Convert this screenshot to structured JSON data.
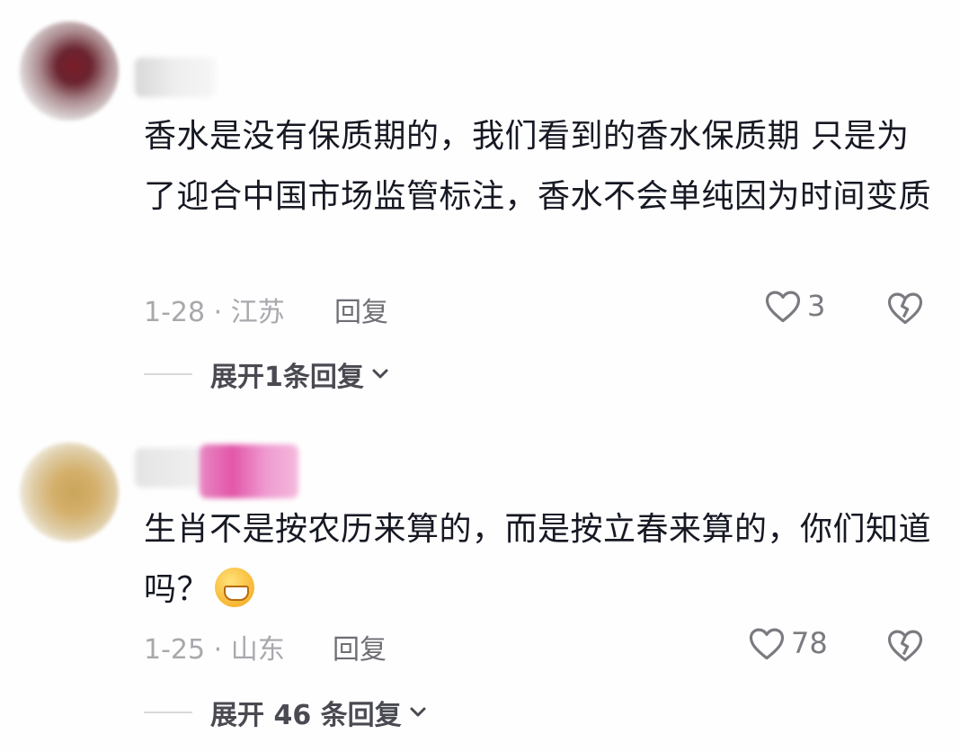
{
  "comments": [
    {
      "text": "香水是没有保质期的，我们看到的香水保质期 只是为了迎合中国市场监管标注，香水不会单纯因为时间变质",
      "date_location": "1-28 · 江苏",
      "reply_label": "回复",
      "likes": "3",
      "expand_label": "展开1条回复"
    },
    {
      "text": "生肖不是按农历来算的，而是按立春来算的，你们知道吗？",
      "emoji": "grinning-face",
      "date_location": "1-25 · 山东",
      "reply_label": "回复",
      "likes": "78",
      "expand_label": "展开 46 条回复"
    }
  ]
}
